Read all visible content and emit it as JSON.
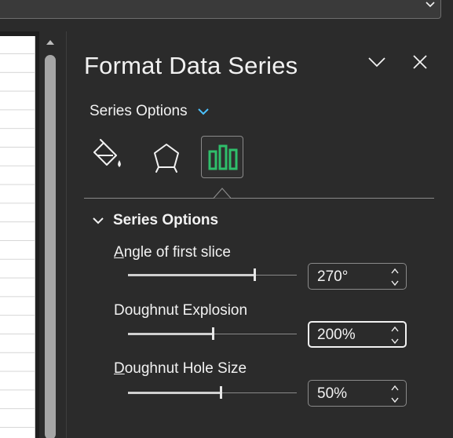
{
  "pane": {
    "title": "Format Data Series",
    "dropdown_label": "Series Options",
    "section_title": "Series Options"
  },
  "tabs": [
    {
      "name": "Fill & Line",
      "icon": "paint-bucket-icon",
      "selected": false
    },
    {
      "name": "Effects",
      "icon": "pentagon-icon",
      "selected": false
    },
    {
      "name": "Series Options",
      "icon": "bar-chart-icon",
      "selected": true
    }
  ],
  "options": {
    "angle": {
      "label": "Angle of first slice",
      "accel": "A",
      "rest": "ngle of first slice",
      "value": "270°",
      "fraction": 0.75
    },
    "explosion": {
      "label": "Doughnut Explosion",
      "value": "200%",
      "fraction": 0.5
    },
    "hole": {
      "label": "Doughnut Hole Size",
      "accel": "D",
      "rest": "oughnut Hole Size",
      "value": "50%",
      "fraction": 0.55
    }
  },
  "colors": {
    "background": "#2b2b2b",
    "text": "#f2f2f2",
    "accent": "#1f9f55",
    "dropdown_chevron": "#4cc2ff"
  }
}
